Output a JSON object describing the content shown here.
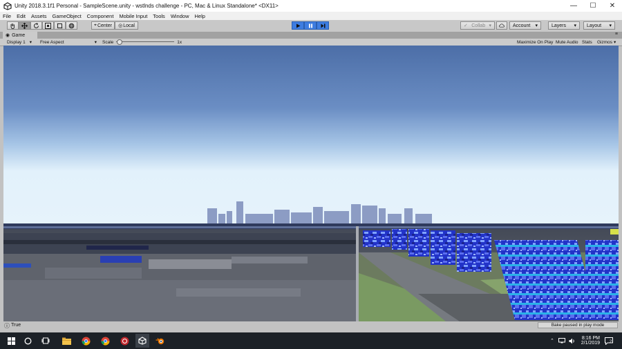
{
  "window": {
    "title": "Unity 2018.3.1f1 Personal - SampleScene.unity - wstlnds challenge - PC, Mac & Linux Standalone* <DX11>",
    "minimize": "—",
    "maximize": "☐",
    "close": "✕"
  },
  "menu": [
    "File",
    "Edit",
    "Assets",
    "GameObject",
    "Component",
    "Mobile Input",
    "Tools",
    "Window",
    "Help"
  ],
  "toolbar": {
    "pivot_label": "Center",
    "space_label": "Local",
    "collab_label": "Collab",
    "account_label": "Account",
    "layers_label": "Layers",
    "layout_label": "Layout"
  },
  "game_tab": {
    "label": "Game",
    "display": "Display 1",
    "aspect": "Free Aspect",
    "scale_label": "Scale",
    "scale_value": "1x",
    "maximize_on_play": "Maximize On Play",
    "mute_audio": "Mute Audio",
    "stats": "Stats",
    "gizmos": "Gizmos"
  },
  "status": {
    "console": "True",
    "bake": "Bake paused in play mode"
  },
  "taskbar": {
    "time": "8:16 PM",
    "date": "2/1/2019",
    "notification_count": "2"
  },
  "colors": {
    "play_active": "#3e7de0",
    "sky_top": "#4d6fa8",
    "sky_horizon": "#e2f1fb",
    "taskbar": "#1c2127"
  }
}
